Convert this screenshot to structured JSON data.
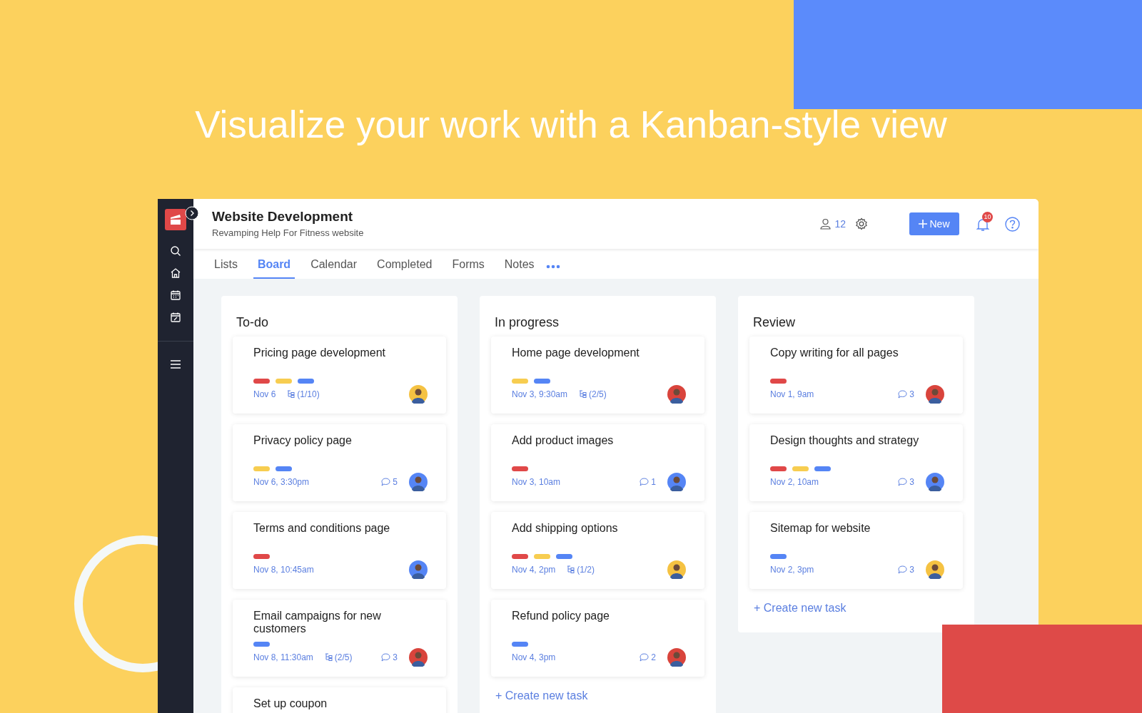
{
  "headline": "Visualize your work with a Kanban-style view",
  "project": {
    "title": "Website Development",
    "subtitle": "Revamping Help For Fitness website",
    "members": "12",
    "new_button": "New",
    "notifications": "10"
  },
  "tabs": [
    {
      "label": "Lists",
      "selected": false
    },
    {
      "label": "Board",
      "selected": true
    },
    {
      "label": "Calendar",
      "selected": false
    },
    {
      "label": "Completed",
      "selected": false
    },
    {
      "label": "Forms",
      "selected": false
    },
    {
      "label": "Notes",
      "selected": false
    }
  ],
  "columns": [
    {
      "title": "To-do",
      "cards": [
        {
          "title": "Pricing page development",
          "tags": [
            {
              "color": "#e04848"
            },
            {
              "color": "#f7cd50"
            },
            {
              "color": "#5585f5"
            }
          ],
          "date": "Nov 6",
          "subtasks": "(1/10)",
          "avatar": {
            "color": "#f5c242"
          }
        },
        {
          "title": "Privacy policy page",
          "tags": [
            {
              "color": "#f7cd50"
            },
            {
              "color": "#5585f5"
            }
          ],
          "date": "Nov 6, 3:30pm",
          "comments": "5",
          "avatar": {
            "color": "#5585f5"
          }
        },
        {
          "title": "Terms and conditions page",
          "tags": [
            {
              "color": "#e04848"
            }
          ],
          "date": "Nov 8, 10:45am",
          "avatar": {
            "color": "#5585f5"
          }
        },
        {
          "title": "Email campaigns for new customers",
          "tags": [
            {
              "color": "#5585f5"
            }
          ],
          "date": "Nov 8, 11:30am",
          "subtasks": "(2/5)",
          "comments": "3",
          "avatar": {
            "color": "#d9443c"
          }
        },
        {
          "title": "Set up coupon"
        }
      ]
    },
    {
      "title": "In progress",
      "cards": [
        {
          "title": "Home page development",
          "tags": [
            {
              "color": "#f7cd50"
            },
            {
              "color": "#5585f5"
            }
          ],
          "date": "Nov 3, 9:30am",
          "subtasks": "(2/5)",
          "avatar": {
            "color": "#d9443c"
          }
        },
        {
          "title": "Add product images",
          "tags": [
            {
              "color": "#e04848"
            }
          ],
          "date": "Nov 3, 10am",
          "comments": "1",
          "avatar": {
            "color": "#5585f5"
          }
        },
        {
          "title": "Add shipping options",
          "tags": [
            {
              "color": "#e04848"
            },
            {
              "color": "#f7cd50"
            },
            {
              "color": "#5585f5"
            }
          ],
          "date": "Nov 4, 2pm",
          "subtasks": "(1/2)",
          "avatar": {
            "color": "#f5c242"
          }
        },
        {
          "title": "Refund policy page",
          "tags": [
            {
              "color": "#5585f5"
            }
          ],
          "date": "Nov 4, 3pm",
          "comments": "2",
          "avatar": {
            "color": "#d9443c"
          }
        }
      ],
      "create_link": "+ Create new task"
    },
    {
      "title": "Review",
      "cards": [
        {
          "title": "Copy writing for all pages",
          "tags": [
            {
              "color": "#e04848"
            }
          ],
          "date": "Nov 1, 9am",
          "comments": "3",
          "avatar": {
            "color": "#d9443c"
          }
        },
        {
          "title": "Design thoughts and strategy",
          "tags": [
            {
              "color": "#e04848"
            },
            {
              "color": "#f7cd50"
            },
            {
              "color": "#5585f5"
            }
          ],
          "date": "Nov 2, 10am",
          "comments": "3",
          "avatar": {
            "color": "#5585f5"
          }
        },
        {
          "title": "Sitemap for website",
          "tags": [
            {
              "color": "#5585f5"
            }
          ],
          "date": "Nov 2, 3pm",
          "comments": "3",
          "avatar": {
            "color": "#f5c242"
          }
        }
      ],
      "create_link": "+ Create new task"
    }
  ]
}
